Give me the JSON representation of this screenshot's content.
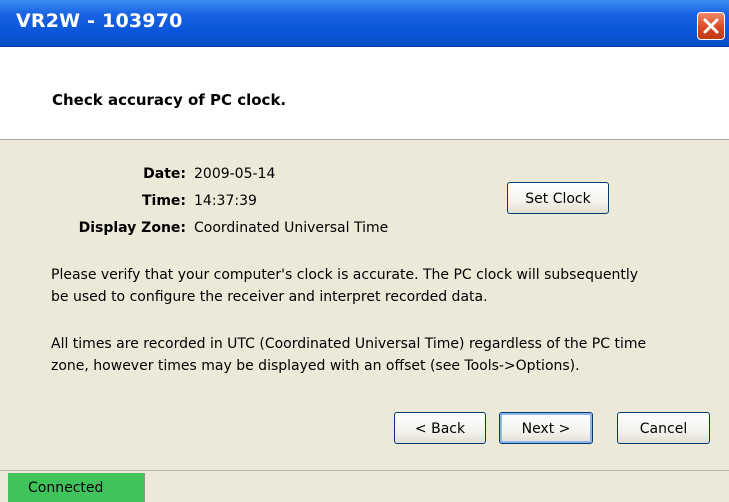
{
  "window": {
    "title": "VR2W - 103970"
  },
  "header": {
    "heading": "Check accuracy of PC clock."
  },
  "clock": {
    "date_label": "Date:",
    "date_value": "2009-05-14",
    "time_label": "Time:",
    "time_value": "14:37:39",
    "zone_label": "Display Zone:",
    "zone_value": "Coordinated Universal Time",
    "set_clock_label": "Set Clock"
  },
  "paragraphs": {
    "verify_line1": "Please verify that your computer's clock is accurate.  The PC clock will subsequently",
    "verify_line2": "be used to configure the receiver and interpret recorded data.",
    "utc_line1": "All times are recorded in UTC (Coordinated Universal Time) regardless of the PC time",
    "utc_line2": "zone, however times may be displayed with an offset (see Tools->Options)."
  },
  "buttons": {
    "back": "< Back",
    "next": "Next >",
    "cancel": "Cancel"
  },
  "status": {
    "connection": "Connected"
  },
  "icons": {
    "close": "close-icon"
  },
  "colors": {
    "titlebar": "#0a55d8",
    "dialog_bg": "#ece9d8",
    "connected": "#3fc35a",
    "close": "#d9451f"
  }
}
